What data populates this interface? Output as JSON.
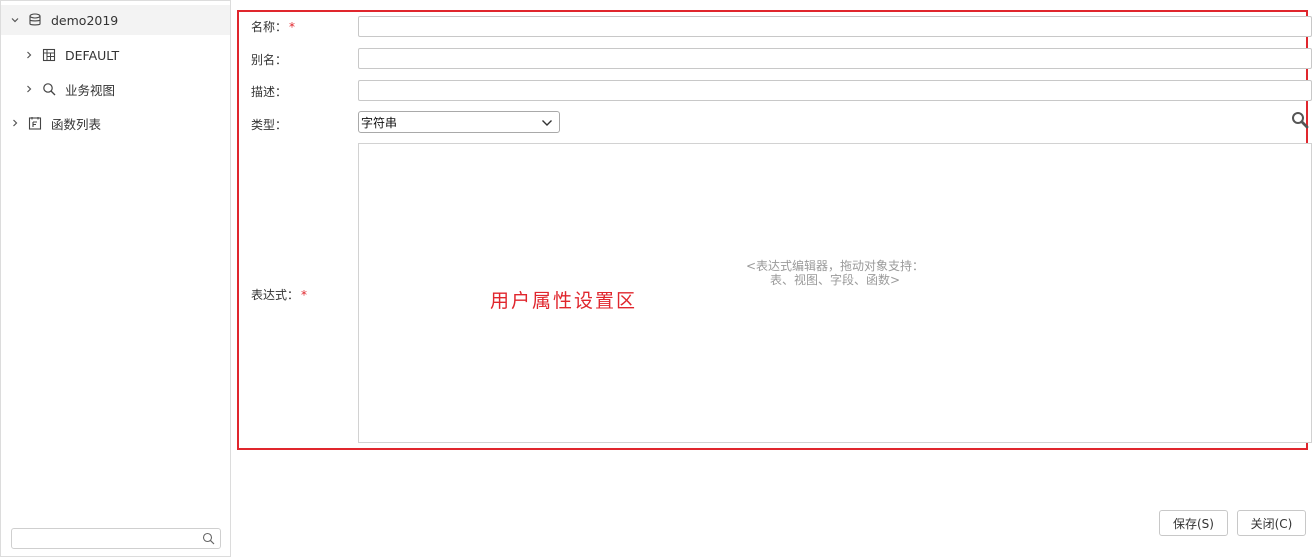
{
  "sidebar": {
    "items": [
      {
        "label": "demo2019",
        "icon": "database-icon",
        "expanded": true,
        "selected": true
      },
      {
        "label": "DEFAULT",
        "icon": "schema-icon",
        "expanded": false
      },
      {
        "label": "业务视图",
        "icon": "search-icon",
        "expanded": false
      },
      {
        "label": "函数列表",
        "icon": "function-list-icon",
        "expanded": false
      }
    ],
    "search": {
      "value": "",
      "placeholder": ""
    }
  },
  "form": {
    "name": {
      "label": "名称：",
      "required_mark": "*",
      "value": ""
    },
    "alias": {
      "label": "别名：",
      "value": ""
    },
    "description": {
      "label": "描述：",
      "value": ""
    },
    "type": {
      "label": "类型：",
      "selected": "字符串"
    },
    "expression": {
      "label": "表达式：",
      "required_mark": "*",
      "hint_line1": "<表达式编辑器，拖动对象支持：",
      "hint_line2": "表、视图、字段、函数>"
    }
  },
  "annotation": {
    "label": "用户属性设置区",
    "color": "#e0262d"
  },
  "buttons": {
    "save": "保存(S)",
    "close": "关闭(C)"
  }
}
